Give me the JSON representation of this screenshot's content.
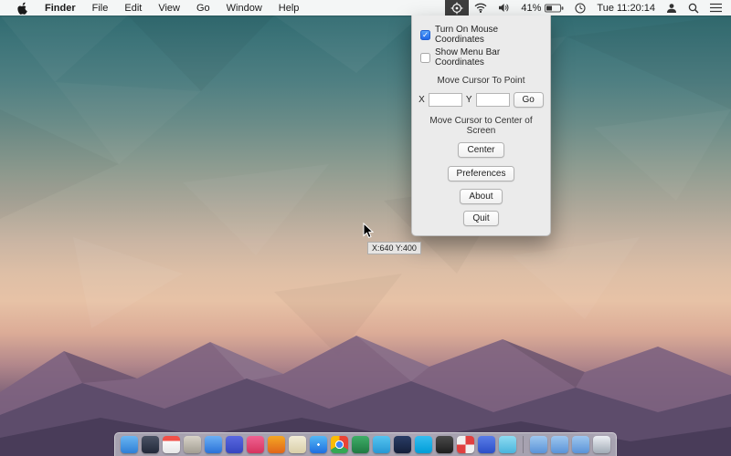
{
  "menu_bar": {
    "items": [
      {
        "label": "Finder"
      },
      {
        "label": "File"
      },
      {
        "label": "Edit"
      },
      {
        "label": "View"
      },
      {
        "label": "Go"
      },
      {
        "label": "Window"
      },
      {
        "label": "Help"
      }
    ],
    "status": {
      "battery_percent": "41%",
      "clock": "Tue 11:20:14"
    }
  },
  "panel": {
    "checkboxes": [
      {
        "label": "Turn On Mouse Coordinates",
        "checked": true
      },
      {
        "label": "Show Menu Bar Coordinates",
        "checked": false
      }
    ],
    "move_point_label": "Move Cursor To Point",
    "x_label": "X",
    "y_label": "Y",
    "x_value": "",
    "y_value": "",
    "go_button": "Go",
    "move_center_label": "Move Cursor to Center of Screen",
    "center_button": "Center",
    "preferences_button": "Preferences",
    "about_button": "About",
    "quit_button": "Quit"
  },
  "desktop": {
    "coordinate_tooltip": "X:640 Y:400"
  },
  "dock": {
    "apps": [
      {
        "name": "finder-icon",
        "color": "linear-gradient(180deg,#6ab6f2,#2e7fd6)"
      },
      {
        "name": "launchpad-icon",
        "color": "linear-gradient(180deg,#4a5264,#23293a)"
      },
      {
        "name": "calendar-icon",
        "color": "linear-gradient(180deg,#f05048 0%,#f05048 30%,#fafafa 30%,#e6e6e6 100%)"
      },
      {
        "name": "contacts-icon",
        "color": "linear-gradient(180deg,#d8d3c8,#a39e93)"
      },
      {
        "name": "mail-icon",
        "color": "linear-gradient(180deg,#6cb0f5,#2a72d8)"
      },
      {
        "name": "app-store-icon",
        "color": "linear-gradient(180deg,#5a68e0,#3546c0)"
      },
      {
        "name": "itunes-icon",
        "color": "linear-gradient(180deg,#f06292,#d6335f)"
      },
      {
        "name": "firefox-icon",
        "color": "linear-gradient(180deg,#f5a623,#e0661a)"
      },
      {
        "name": "maps-icon",
        "color": "linear-gradient(180deg,#f2ecd8,#d9cfa8)"
      },
      {
        "name": "safari-icon",
        "color": "radial-gradient(circle at 50% 50%, #ffffff 0 10%, rgba(0,0,0,0) 11%), linear-gradient(180deg,#54b8f5,#1e6fe0)"
      },
      {
        "name": "chrome-icon",
        "color": "radial-gradient(circle at 50% 50%, #4285f4 0 26%, #ffffff 27% 34%, rgba(0,0,0,0) 35%), conic-gradient(#ea4335 0 120deg, #34a853 0 240deg, #fbbc05 0 360deg)"
      },
      {
        "name": "excel-icon",
        "color": "linear-gradient(180deg,#3fae68,#1f7a42)"
      },
      {
        "name": "twitter-icon",
        "color": "linear-gradient(180deg,#55c4f0,#2698d4)"
      },
      {
        "name": "photoshop-icon",
        "color": "linear-gradient(180deg,#2a3d66,#141f3a)"
      },
      {
        "name": "skype-icon",
        "color": "linear-gradient(180deg,#35bdf0,#009ed8)"
      },
      {
        "name": "terminal-icon",
        "color": "linear-gradient(180deg,#4a4a4a,#1e1e1e)"
      },
      {
        "name": "pinwheel-icon",
        "color": "conic-gradient(#e04040 0 90deg, #f0f0f0 0 180deg, #e04040 0 270deg, #f0f0f0 0 360deg)"
      },
      {
        "name": "cube-icon",
        "color": "linear-gradient(180deg,#5a7de8,#2b4fc8)"
      },
      {
        "name": "box-icon",
        "color": "linear-gradient(180deg,#8edcf2,#4ab4dc)"
      }
    ],
    "right": [
      {
        "name": "minimized-window-icon-1",
        "color": "linear-gradient(180deg,#9ec7ef,#5a93d8)"
      },
      {
        "name": "minimized-window-icon-2",
        "color": "linear-gradient(180deg,#9ec7ef,#5a93d8)"
      },
      {
        "name": "minimized-window-icon-3",
        "color": "linear-gradient(180deg,#9ec7ef,#5a93d8)"
      },
      {
        "name": "trash-icon",
        "color": "linear-gradient(180deg,rgba(240,244,248,0.95),rgba(162,172,182,0.95))"
      }
    ]
  }
}
